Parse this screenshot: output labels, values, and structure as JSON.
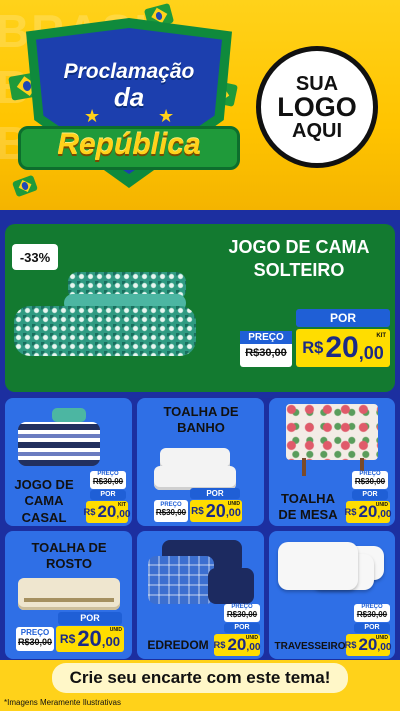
{
  "header": {
    "bg_words": [
      "BRASIL",
      "BRASIL",
      "BRASIL"
    ],
    "title_line1": "Proclamação",
    "title_line2": "da",
    "title_line3": "República",
    "logo_line1": "SUA",
    "logo_line2": "LOGO",
    "logo_line3": "AQUI"
  },
  "hero": {
    "discount": "-33%",
    "title": "JOGO DE CAMA SOLTEIRO",
    "preco_label": "PREÇO",
    "old_price": "R$30,00",
    "por_label": "POR",
    "price_currency": "R$",
    "price_int": "20",
    "price_cents": ",00",
    "unit": "KIT"
  },
  "products": [
    {
      "title": "JOGO DE CAMA CASAL",
      "preco_label": "PREÇO",
      "old_price": "R$30,00",
      "por_label": "POR",
      "currency": "R$",
      "price_int": "20",
      "price_cents": ",00",
      "unit": "KIT"
    },
    {
      "title": "TOALHA DE BANHO",
      "preco_label": "PREÇO",
      "old_price": "R$30,00",
      "por_label": "POR",
      "currency": "R$",
      "price_int": "20",
      "price_cents": ",00",
      "unit": "UNID"
    },
    {
      "title": "TOALHA DE MESA",
      "preco_label": "PREÇO",
      "old_price": "R$30,00",
      "por_label": "POR",
      "currency": "R$",
      "price_int": "20",
      "price_cents": ",00",
      "unit": "UNID"
    },
    {
      "title": "TOALHA DE ROSTO",
      "preco_label": "PREÇO",
      "old_price": "R$30,00",
      "por_label": "POR",
      "currency": "R$",
      "price_int": "20",
      "price_cents": ",00",
      "unit": "UNID"
    },
    {
      "title": "EDREDOM",
      "preco_label": "PREÇO",
      "old_price": "R$30,00",
      "por_label": "POR",
      "currency": "R$",
      "price_int": "20",
      "price_cents": ",00",
      "unit": "UNID"
    },
    {
      "title": "TRAVESSEIRO",
      "preco_label": "PREÇO",
      "old_price": "R$30,00",
      "por_label": "POR",
      "currency": "R$",
      "price_int": "20",
      "price_cents": ",00",
      "unit": "UNID"
    }
  ],
  "cta": {
    "label": "Crie seu encarte com este tema!"
  },
  "footer": {
    "disclaimer": "*Imagens Meramente Ilustrativas"
  },
  "colors": {
    "yellow": "#ffd21a",
    "green": "#137a30",
    "blue_bg": "#1c2fa0",
    "card_blue": "#2f6fe6",
    "price_yellow": "#ffdd00"
  }
}
